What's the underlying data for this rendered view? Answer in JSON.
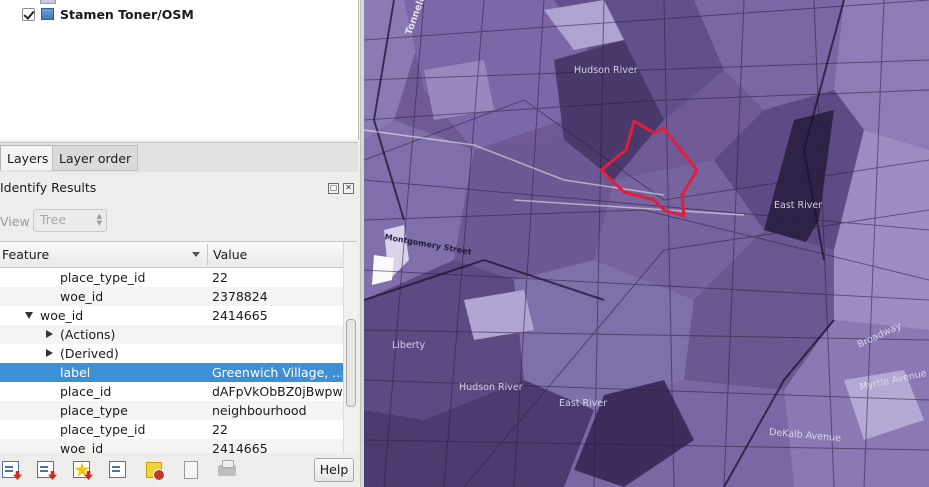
{
  "layers_panel": {
    "layer": {
      "name": "Stamen Toner/OSM",
      "checked": true,
      "icon": "raster-layer-icon"
    }
  },
  "tabs": [
    {
      "label": "Layers",
      "active": true
    },
    {
      "label": "Layer order",
      "active": false
    }
  ],
  "identify": {
    "title": "Identify Results",
    "view_label": "View",
    "view_value": "Tree",
    "columns": {
      "feature": "Feature",
      "value": "Value"
    },
    "rows": [
      {
        "feature": "place_type_id",
        "value": "22"
      },
      {
        "feature": "woe_id",
        "value": "2378824"
      },
      {
        "feature": "woe_id",
        "value": "2414665"
      },
      {
        "feature": "(Actions)",
        "value": ""
      },
      {
        "feature": "(Derived)",
        "value": ""
      },
      {
        "feature": "label",
        "value": "Greenwich Village, ..."
      },
      {
        "feature": "place_id",
        "value": "dAFpVkObBZ0jBwpw"
      },
      {
        "feature": "place_type",
        "value": "neighbourhood"
      },
      {
        "feature": "place_type_id",
        "value": "22"
      },
      {
        "feature": "woe_id",
        "value": "2414665"
      }
    ],
    "help_label": "Help"
  },
  "map": {
    "labels": [
      "Tonnelle",
      "Hudson River",
      "East River",
      "Montgomery Street",
      "Liberty",
      "Hudson River",
      "East River",
      "Broadway",
      "Myrtle Avenue",
      "DeKalb Avenue"
    ],
    "colors": {
      "base": "#6f5a96",
      "light": "#a999c9",
      "dark": "#3a2c55",
      "highlight": "#e0203a"
    }
  }
}
